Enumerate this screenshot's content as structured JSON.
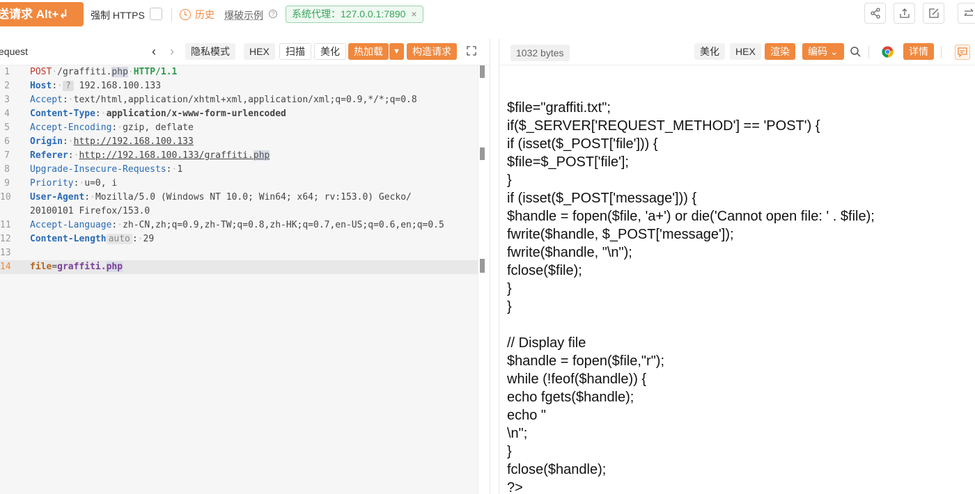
{
  "toolbar": {
    "send_label": "送请求 Alt+↲",
    "force_https_label": "强制 HTTPS",
    "history_label": "历史",
    "example_label": "爆破示例",
    "proxy_label": "系统代理：127.0.0.1:7890",
    "proxy_close": "×"
  },
  "request": {
    "title": "equest",
    "buttons": {
      "privacy": "隐私模式",
      "hex": "HEX",
      "scan": "扫描",
      "beautify": "美化",
      "hotload": "热加载",
      "build": "构造请求"
    },
    "lines": [
      {
        "n": "1"
      },
      {
        "n": "2"
      },
      {
        "n": "3"
      },
      {
        "n": "4"
      },
      {
        "n": "5"
      },
      {
        "n": "6"
      },
      {
        "n": "7"
      },
      {
        "n": "8"
      },
      {
        "n": "9"
      },
      {
        "n": "10"
      },
      {
        "n": ""
      },
      {
        "n": "11"
      },
      {
        "n": "12"
      },
      {
        "n": "13"
      },
      {
        "n": "14"
      }
    ],
    "method": "POST",
    "path_prefix": "/graffiti.",
    "path_ext": "php",
    "version": "HTTP/1.1",
    "host_key": "Host",
    "host_badge": "?",
    "host_value": "192.168.100.133",
    "accept_key": "Accept",
    "accept_value": "text/html,application/xhtml+xml,application/xml;q=0.9,*/*;q=0.8",
    "ctype_key": "Content-Type",
    "ctype_value": "application/x-www-form-urlencoded",
    "aenc_key": "Accept-Encoding",
    "aenc_value": "gzip, deflate",
    "origin_key": "Origin",
    "origin_value": "http://192.168.100.133",
    "referer_key": "Referer",
    "referer_value_prefix": "http://192.168.100.133/graffiti.",
    "referer_value_ext": "php",
    "uir_key": "Upgrade-Insecure-Requests",
    "uir_value": "1",
    "priority_key": "Priority",
    "priority_value": "u=0, i",
    "ua_key": "User-Agent",
    "ua_value": "Mozilla/5.0 (Windows NT 10.0; Win64; x64; rv:153.0) Gecko/",
    "ua_value_cont": "20100101 Firefox/153.0",
    "alang_key": "Accept-Language",
    "alang_value": "zh-CN,zh;q=0.9,zh-TW;q=0.8,zh-HK;q=0.7,en-US;q=0.6,en;q=0.5",
    "clen_key": "Content-Length",
    "clen_badge": "auto",
    "clen_value": "29",
    "body_key": "file",
    "body_value_prefix": "graffiti.",
    "body_value_ext": "php"
  },
  "response": {
    "bytes": "1032 bytes",
    "buttons": {
      "beautify": "美化",
      "hex": "HEX",
      "render": "渲染",
      "encode": "编码",
      "detail": "详情"
    },
    "body": "$file=\"graffiti.txt\";\nif($_SERVER['REQUEST_METHOD'] == 'POST') {\nif (isset($_POST['file'])) {\n$file=$_POST['file'];\n}\nif (isset($_POST['message'])) {\n$handle = fopen($file, 'a+') or die('Cannot open file: ' . $file);\nfwrite($handle, $_POST['message']);\nfwrite($handle, \"\\n\");\nfclose($file);\n}\n}\n\n// Display file\n$handle = fopen($file,\"r\");\nwhile (!feof($handle)) {\necho fgets($handle);\necho \"\n\\n\";\n}\nfclose($handle);\n?>"
  },
  "colors": {
    "accent": "#f0883e",
    "proxy_green": "#3aa35b"
  }
}
